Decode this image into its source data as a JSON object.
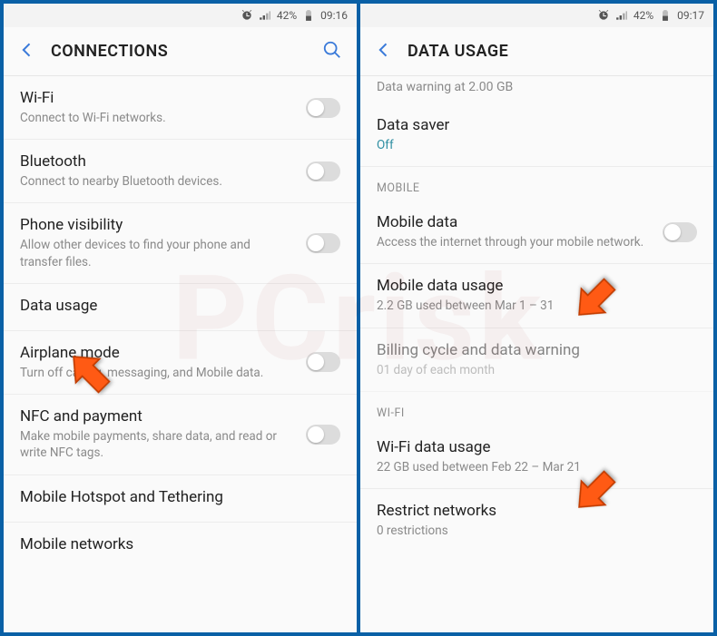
{
  "status": {
    "battery": "42%",
    "time_left": "09:16",
    "time_right": "09:17"
  },
  "left": {
    "title": "CONNECTIONS",
    "rows": {
      "wifi": {
        "title": "Wi-Fi",
        "sub": "Connect to Wi-Fi networks."
      },
      "bluetooth": {
        "title": "Bluetooth",
        "sub": "Connect to nearby Bluetooth devices."
      },
      "phonevis": {
        "title": "Phone visibility",
        "sub": "Allow other devices to find your phone and transfer files."
      },
      "datausage": {
        "title": "Data usage"
      },
      "airplane": {
        "title": "Airplane mode",
        "sub": "Turn off calling, messaging, and Mobile data."
      },
      "nfc": {
        "title": "NFC and payment",
        "sub": "Make mobile payments, share data, and read or write NFC tags."
      },
      "hotspot": {
        "title": "Mobile Hotspot and Tethering"
      },
      "networks": {
        "title": "Mobile networks"
      }
    }
  },
  "right": {
    "title": "DATA USAGE",
    "data_warning_sub": "Data warning at 2.00 GB",
    "data_saver": {
      "title": "Data saver",
      "status": "Off"
    },
    "section_mobile": "MOBILE",
    "mobile_data": {
      "title": "Mobile data",
      "sub": "Access the internet through your mobile network."
    },
    "mobile_usage": {
      "title": "Mobile data usage",
      "sub": "2.2 GB used between Mar 1 – 31"
    },
    "billing": {
      "title": "Billing cycle and data warning",
      "sub": "01 day of each month"
    },
    "section_wifi": "WI-FI",
    "wifi_usage": {
      "title": "Wi-Fi data usage",
      "sub": "22 GB used between Feb 22 – Mar 21"
    },
    "restrict": {
      "title": "Restrict networks",
      "sub": "0 restrictions"
    }
  }
}
